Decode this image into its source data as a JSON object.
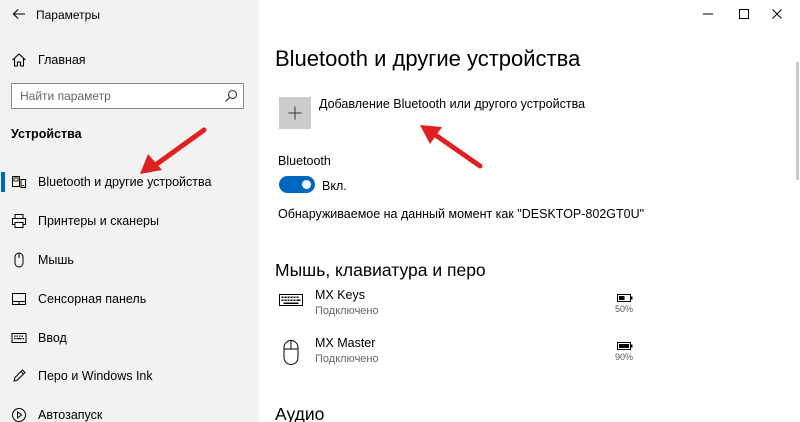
{
  "window": {
    "title": "Параметры",
    "controls": [
      "minimize",
      "maximize",
      "close"
    ]
  },
  "sidebar": {
    "home_label": "Главная",
    "search_placeholder": "Найти параметр",
    "section": "Устройства",
    "items": [
      {
        "label": "Bluetooth и другие устройства",
        "icon": "bluetooth-devices-icon",
        "active": true
      },
      {
        "label": "Принтеры и сканеры",
        "icon": "printer-icon",
        "active": false
      },
      {
        "label": "Мышь",
        "icon": "mouse-icon",
        "active": false
      },
      {
        "label": "Сенсорная панель",
        "icon": "touchpad-icon",
        "active": false
      },
      {
        "label": "Ввод",
        "icon": "keyboard-icon",
        "active": false
      },
      {
        "label": "Перо и Windows Ink",
        "icon": "pen-icon",
        "active": false
      },
      {
        "label": "Автозапуск",
        "icon": "autoplay-icon",
        "active": false
      }
    ]
  },
  "main": {
    "title": "Bluetooth и другие устройства",
    "add_device_label": "Добавление Bluetooth или другого устройства",
    "bluetooth_label": "Bluetooth",
    "bluetooth_state": "Вкл.",
    "bluetooth_on": true,
    "discoverable_text": "Обнаруживаемое на данный момент как \"DESKTOP-802GT0U\"",
    "section_input": "Мышь, клавиатура и перо",
    "devices": [
      {
        "name": "MX Keys",
        "status": "Подключено",
        "battery": "50%",
        "icon": "keyboard-icon"
      },
      {
        "name": "MX Master",
        "status": "Подключено",
        "battery": "90%",
        "icon": "mouse-icon"
      }
    ],
    "section_audio": "Аудио"
  },
  "colors": {
    "accent": "#0067c0",
    "sidebar_bg": "#f2f2f2",
    "arrow": "#e02020"
  }
}
